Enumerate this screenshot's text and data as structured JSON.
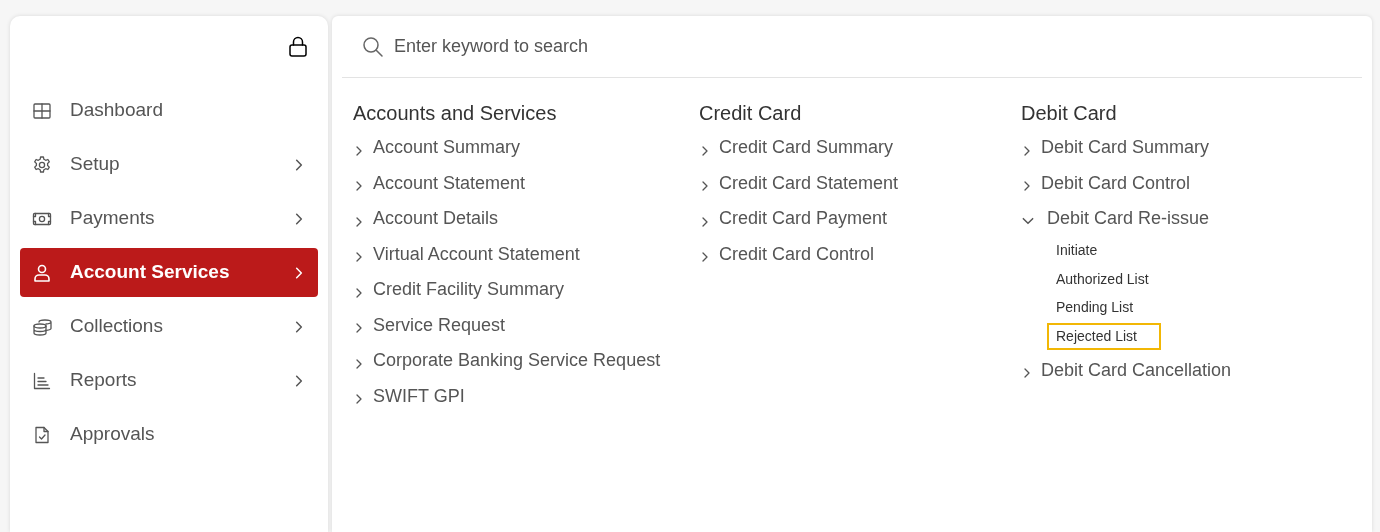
{
  "sidebar": {
    "items": [
      {
        "label": "Dashboard",
        "selected": false,
        "has_submenu": false
      },
      {
        "label": "Setup",
        "selected": false,
        "has_submenu": true
      },
      {
        "label": "Payments",
        "selected": false,
        "has_submenu": true
      },
      {
        "label": "Account Services",
        "selected": true,
        "has_submenu": true
      },
      {
        "label": "Collections",
        "selected": false,
        "has_submenu": true
      },
      {
        "label": "Reports",
        "selected": false,
        "has_submenu": true
      },
      {
        "label": "Approvals",
        "selected": false,
        "has_submenu": false
      }
    ]
  },
  "search": {
    "placeholder": "Enter keyword to search"
  },
  "menu_columns": [
    {
      "heading": "Accounts and Services",
      "items": [
        {
          "label": "Account Summary",
          "expanded": false
        },
        {
          "label": "Account Statement",
          "expanded": false
        },
        {
          "label": "Account Details",
          "expanded": false
        },
        {
          "label": "Virtual Account Statement",
          "expanded": false
        },
        {
          "label": "Credit Facility Summary",
          "expanded": false
        },
        {
          "label": "Service Request",
          "expanded": false
        },
        {
          "label": "Corporate Banking Service Request",
          "expanded": false
        },
        {
          "label": "SWIFT GPI",
          "expanded": false
        }
      ]
    },
    {
      "heading": "Credit Card",
      "items": [
        {
          "label": "Credit Card Summary",
          "expanded": false
        },
        {
          "label": "Credit Card Statement",
          "expanded": false
        },
        {
          "label": "Credit Card Payment",
          "expanded": false
        },
        {
          "label": "Credit Card Control",
          "expanded": false
        }
      ]
    },
    {
      "heading": "Debit Card",
      "items": [
        {
          "label": "Debit Card Summary",
          "expanded": false
        },
        {
          "label": "Debit Card Control",
          "expanded": false
        },
        {
          "label": "Debit Card Re-issue",
          "expanded": true,
          "children": [
            {
              "label": "Initiate",
              "selected": false
            },
            {
              "label": "Authorized List",
              "selected": false
            },
            {
              "label": "Pending List",
              "selected": false
            },
            {
              "label": "Rejected List",
              "selected": true
            }
          ]
        },
        {
          "label": "Debit Card Cancellation",
          "expanded": false
        }
      ]
    }
  ]
}
